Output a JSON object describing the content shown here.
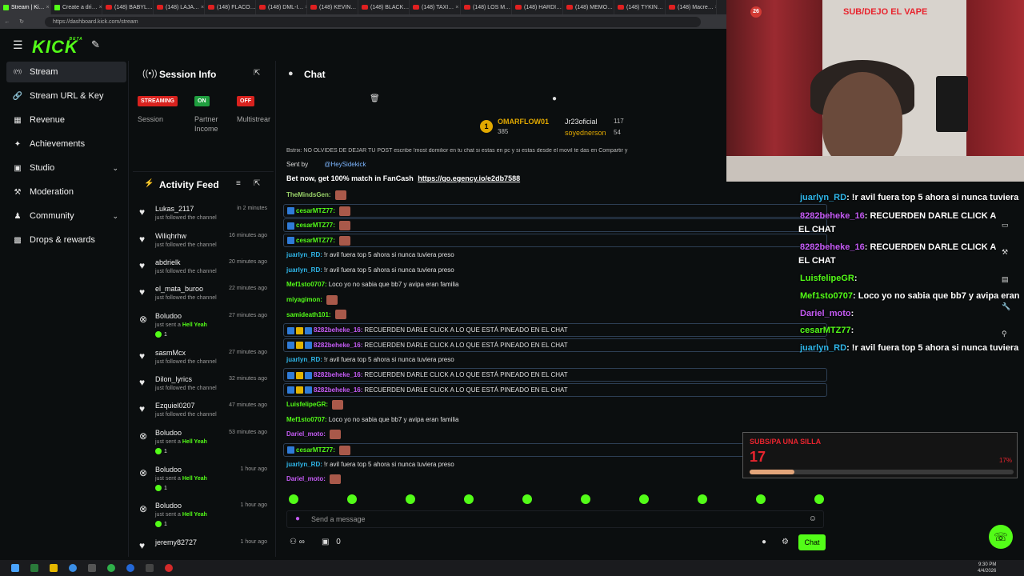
{
  "browser": {
    "tabs": [
      "Stream | Ki…",
      "Create a dri…",
      "(148) BABYL…",
      "(148) LAJA…",
      "(148) FLACO…",
      "(148) DML-I…",
      "(148) KEVIN…",
      "(148) BLACK…",
      "(148) TAXI…",
      "(148) LOS M…",
      "(148) HARDI…",
      "(148) MEMO…",
      "(148) TYKIN…",
      "(148) Macre…"
    ],
    "url": "https://dashboard.kick.com/stream"
  },
  "header": {
    "logo": "KICK",
    "logo_sup": "BETA"
  },
  "sidebar": {
    "items": [
      {
        "label": "Stream",
        "icon": "broadcast-icon",
        "glyph": "((•))"
      },
      {
        "label": "Stream URL & Key",
        "icon": "link-icon",
        "glyph": "🔗"
      },
      {
        "label": "Revenue",
        "icon": "revenue-icon",
        "glyph": "▦"
      },
      {
        "label": "Achievements",
        "icon": "trophy-icon",
        "glyph": "✦"
      },
      {
        "label": "Studio",
        "icon": "studio-icon",
        "glyph": "▣"
      },
      {
        "label": "Moderation",
        "icon": "hammer-icon",
        "glyph": "⚒"
      },
      {
        "label": "Community",
        "icon": "people-icon",
        "glyph": "♟"
      },
      {
        "label": "Drops & rewards",
        "icon": "gift-icon",
        "glyph": "▩"
      }
    ]
  },
  "session": {
    "title": "Session Info",
    "statuses": [
      {
        "badge": "STREAMING",
        "label": "Session",
        "color": "#d9221e"
      },
      {
        "badge": "ON",
        "label": "Partner\nIncome",
        "color": "#1f9e3f"
      },
      {
        "badge": "OFF",
        "label": "Multistrear",
        "color": "#d9221e"
      }
    ]
  },
  "activity": {
    "title": "Activity Feed",
    "rows": [
      {
        "name": "Lukas_2117",
        "sub": "just followed the channel",
        "time": "in 2 minutes",
        "type": "follow"
      },
      {
        "name": "Wiliqhrhw",
        "sub": "just followed the channel",
        "time": "16 minutes ago",
        "type": "follow"
      },
      {
        "name": "abdrielk",
        "sub": "just followed the channel",
        "time": "20 minutes ago",
        "type": "follow"
      },
      {
        "name": "el_mata_buroo",
        "sub": "just followed the channel",
        "time": "22 minutes ago",
        "type": "follow"
      },
      {
        "name": "Boludoo",
        "sub": "just sent a",
        "sub_b": "Hell Yeah",
        "time": "27 minutes ago",
        "type": "gift",
        "count": "1"
      },
      {
        "name": "sasmMcx",
        "sub": "just followed the channel",
        "time": "27 minutes ago",
        "type": "follow"
      },
      {
        "name": "Dilon_lyrics",
        "sub": "just followed the channel",
        "time": "32 minutes ago",
        "type": "follow"
      },
      {
        "name": "Ezquiel0207",
        "sub": "just followed the channel",
        "time": "47 minutes ago",
        "type": "follow"
      },
      {
        "name": "Boludoo",
        "sub": "just sent a",
        "sub_b": "Hell Yeah",
        "time": "53 minutes ago",
        "type": "gift",
        "count": "1"
      },
      {
        "name": "Boludoo",
        "sub": "just sent a",
        "sub_b": "Hell Yeah",
        "time": "1 hour ago",
        "type": "gift",
        "count": "1"
      },
      {
        "name": "Boludoo",
        "sub": "just sent a",
        "sub_b": "Hell Yeah",
        "time": "1 hour ago",
        "type": "gift",
        "count": "1"
      },
      {
        "name": "jeremy82727",
        "sub": "",
        "time": "1 hour ago",
        "type": "follow"
      }
    ]
  },
  "chat": {
    "title": "Chat",
    "leaderboard": [
      {
        "name": "OMARFLOW01",
        "value": "385"
      },
      {
        "name": "Jr23oficial",
        "value": "117"
      },
      {
        "name": "soyednerson",
        "value": "54"
      }
    ],
    "top_banner": "Bstrix: NO OLVIDES DE DEJAR TU POST escribe !most domilior en tu chat si estas en pc y si estas desde el movil te das en Compartir y",
    "sent_by_label": "Sent by",
    "sent_by_user": "@HeySidekick",
    "promo_text": "Bet now, get 100% match in FanCash",
    "promo_link": "https://go.egency.io/e2db7588",
    "messages": [
      {
        "user": "TheMindsGen:",
        "text": "",
        "color": "#9bd46a",
        "emote": true,
        "pinned": false
      },
      {
        "user": "cesarMTZ77:",
        "text": "",
        "color": "#53fc18",
        "emote": true,
        "pinned": true
      },
      {
        "user": "cesarMTZ77:",
        "text": "",
        "color": "#53fc18",
        "emote": true,
        "pinned": true
      },
      {
        "user": "cesarMTZ77:",
        "text": "",
        "color": "#53fc18",
        "emote": true,
        "pinned": true
      },
      {
        "user": "juarlyn_RD:",
        "text": "!r avil fuera top 5 ahora si nunca tuviera preso",
        "color": "#2fb7ea",
        "emote": false,
        "pinned": false
      },
      {
        "user": "juarlyn_RD:",
        "text": "!r avil fuera top 5 ahora si nunca tuviera preso",
        "color": "#2fb7ea",
        "emote": false,
        "pinned": false
      },
      {
        "user": "Mef1sto0707:",
        "text": "Loco yo no sabia que bb7 y avipa eran familia",
        "color": "#53fc18",
        "emote": false,
        "pinned": false
      },
      {
        "user": "miyagimon:",
        "text": "",
        "color": "#53fc18",
        "emote": true,
        "pinned": false
      },
      {
        "user": "samideath101:",
        "text": "",
        "color": "#53fc18",
        "emote": true,
        "pinned": false
      },
      {
        "user": "8282beheke_16:",
        "text": "RECUERDEN DARLE CLICK A LO QUE ESTÁ PINEADO EN EL CHAT",
        "color": "#c55bf5",
        "emote": false,
        "pinned": true
      },
      {
        "user": "8282beheke_16:",
        "text": "RECUERDEN DARLE CLICK A LO QUE ESTÁ PINEADO EN EL CHAT",
        "color": "#c55bf5",
        "emote": false,
        "pinned": true
      },
      {
        "user": "juarlyn_RD:",
        "text": "!r avil fuera top 5 ahora si nunca tuviera preso",
        "color": "#2fb7ea",
        "emote": false,
        "pinned": false
      },
      {
        "user": "8282beheke_16:",
        "text": "RECUERDEN DARLE CLICK A LO QUE ESTÁ PINEADO EN EL CHAT",
        "color": "#c55bf5",
        "emote": false,
        "pinned": true
      },
      {
        "user": "8282beheke_16:",
        "text": "RECUERDEN DARLE CLICK A LO QUE ESTÁ PINEADO EN EL CHAT",
        "color": "#c55bf5",
        "emote": false,
        "pinned": true
      },
      {
        "user": "LuisfelipeGR:",
        "text": "",
        "color": "#53fc18",
        "emote": true,
        "pinned": false
      },
      {
        "user": "Mef1sto0707:",
        "text": "Loco yo no sabia que bb7 y avipa eran familia",
        "color": "#53fc18",
        "emote": false,
        "pinned": false
      },
      {
        "user": "Dariel_moto:",
        "text": "",
        "color": "#c55bf5",
        "emote": true,
        "pinned": false
      },
      {
        "user": "cesarMTZ77:",
        "text": "",
        "color": "#53fc18",
        "emote": true,
        "pinned": true
      },
      {
        "user": "juarlyn_RD:",
        "text": "!r avil fuera top 5 ahora si nunca tuviera preso",
        "color": "#2fb7ea",
        "emote": false,
        "pinned": false
      },
      {
        "user": "Dariel_moto:",
        "text": "",
        "color": "#c55bf5",
        "emote": true,
        "pinned": false
      }
    ],
    "input_placeholder": "Send a message",
    "viewer_count": "∞",
    "gift_count": "0",
    "send_label": "Chat"
  },
  "webcam": {
    "counter": "26",
    "overlay_text": "SUB/DEJO EL VAPE",
    "overlay_chat": [
      {
        "user": "juarlyn_RD",
        "text": ": !r avil fuera top 5 ahora si nunca tuviera",
        "color": "#2fb7ea"
      },
      {
        "user": "8282beheke_16",
        "text": ": RECUERDEN DARLE CLICK A",
        "color": "#c55bf5",
        "cont": "EL CHAT"
      },
      {
        "user": "8282beheke_16",
        "text": ": RECUERDEN DARLE CLICK A",
        "color": "#c55bf5",
        "cont": "EL CHAT"
      },
      {
        "user": "LuisfelipeGR",
        "text": ":",
        "color": "#53fc18"
      },
      {
        "user": "Mef1sto0707",
        "text": ": Loco yo no sabia que bb7 y avipa eran",
        "color": "#53fc18"
      },
      {
        "user": "Dariel_moto",
        "text": ":",
        "color": "#c55bf5"
      },
      {
        "user": "cesarMTZ77",
        "text": ":",
        "color": "#53fc18"
      },
      {
        "user": "juarlyn_RD",
        "text": ": !r avil fuera top 5 ahora si nunca tuviera",
        "color": "#2fb7ea"
      }
    ]
  },
  "goal": {
    "title": "SUBS/PA UNA SILLA",
    "current": "17",
    "percent_label": "17%",
    "progress": 0.17
  },
  "taskbar": {
    "time": "9:30 PM",
    "date": "4/4/2026"
  }
}
